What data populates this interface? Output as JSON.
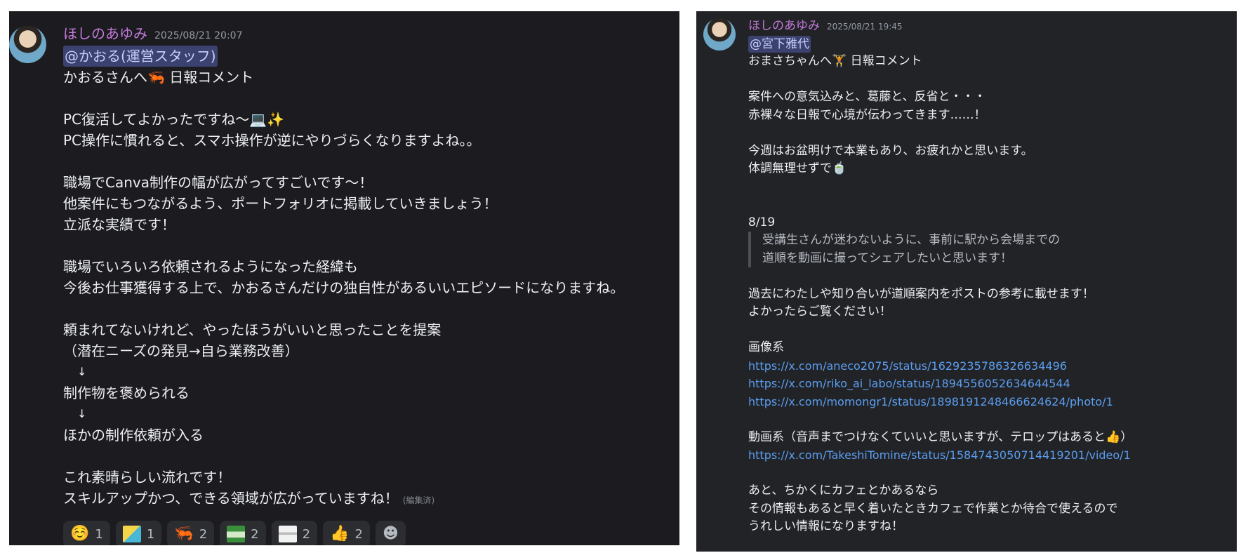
{
  "left": {
    "username": "ほしのあゆみ",
    "timestamp": "2025/08/21 20:07",
    "mention": "@かおる(運営スタッフ)",
    "lines": [
      "かおるさんへ🦐 日報コメント",
      "",
      "PC復活してよかったですね〜💻✨",
      "PC操作に慣れると、スマホ操作が逆にやりづらくなりますよね。。",
      "",
      "職場でCanva制作の幅が広がってすごいです〜！",
      "他案件にもつながるよう、ポートフォリオに掲載していきましょう！",
      "立派な実績です！",
      "",
      "職場でいろいろ依頼されるようになった経緯も",
      "今後お仕事獲得する上で、かおるさんだけの独自性があるいいエピソードになりますね。",
      "",
      "頼まれてないけれど、やったほうがいいと思ったことを提案",
      "（潜在ニーズの発見→自ら業務改善）"
    ],
    "arrow1": "↓",
    "line_after_arrow1": "制作物を褒められる",
    "arrow2": "↓",
    "line_after_arrow2": "ほかの制作依頼が入る",
    "closing_lines": [
      "これ素晴らしい流れです！",
      "スキルアップかつ、できる領域が広がっていますね！"
    ],
    "edited_label": "(編集済)",
    "reactions": [
      {
        "emoji": "☺️",
        "count": "1",
        "icon": "smiling-face-icon"
      },
      {
        "emoji": "",
        "count": "1",
        "icon": "cartoon-sticker-icon"
      },
      {
        "emoji": "🦐",
        "count": "2",
        "icon": "shrimp-icon"
      },
      {
        "emoji": "",
        "count": "2",
        "icon": "green-sign-icon"
      },
      {
        "emoji": "",
        "count": "2",
        "icon": "paper-sticker-icon"
      },
      {
        "emoji": "👍",
        "count": "2",
        "icon": "thumbs-up-icon"
      }
    ],
    "add_reaction_icon": "☻"
  },
  "right": {
    "username": "ほしのあゆみ",
    "timestamp": "2025/08/21 19:45",
    "mention": "@宮下雅代",
    "lines_top": [
      "おまさちゃんへ🏋️ 日報コメント",
      "",
      "案件への意気込みと、葛藤と、反省と・・・",
      "赤裸々な日報で心境が伝わってきます……！",
      "",
      "今週はお盆明けで本業もあり、お疲れかと思います。",
      "体調無理せずで🍵",
      "",
      "",
      "8/19"
    ],
    "quote_lines": [
      "受講生さんが迷わないように、事前に駅から会場までの",
      "道順を動画に撮ってシェアしたいと思います！"
    ],
    "lines_mid": [
      "過去にわたしや知り合いが道順案内をポストの参考に載せます！",
      "よかったらご覧ください！",
      "",
      "画像系"
    ],
    "links_image": [
      "https://x.com/aneco2075/status/1629235786326634496",
      "https://x.com/riko_ai_labo/status/1894556052634644544",
      "https://x.com/momongr1/status/1898191248466624624/photo/1"
    ],
    "video_heading": "動画系（音声までつけなくていいと思いますが、テロップはあると👍）",
    "links_video": [
      "https://x.com/TakeshiTomine/status/1584743050714419201/video/1"
    ],
    "lines_bottom": [
      "あと、ちかくにカフェとかあるなら",
      "その情報もあると早く着いたときカフェで作業とか待合で使えるので",
      "うれしい情報になりますね！"
    ]
  }
}
